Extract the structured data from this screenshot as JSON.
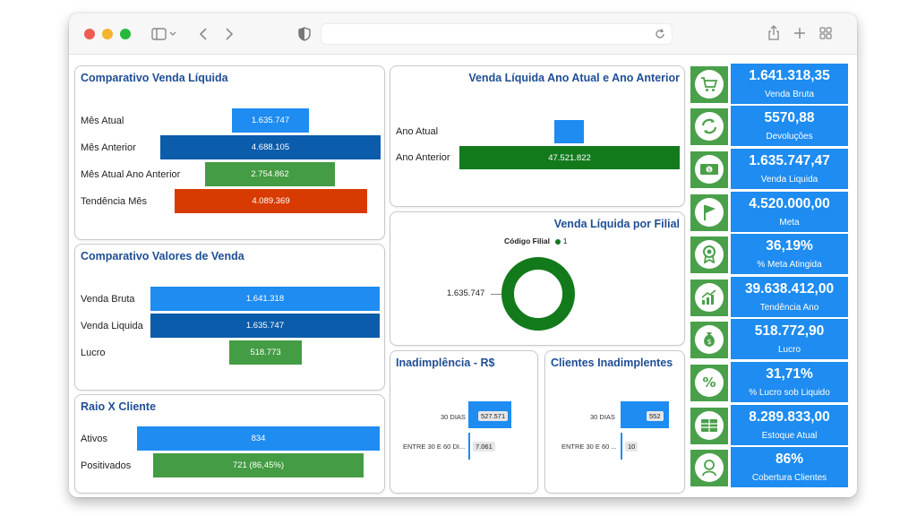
{
  "colors": {
    "primary_blue": "#1e8cf0",
    "dark_blue": "#0b5cab",
    "green_bar": "#449c44",
    "dark_green": "#137a1c",
    "orange": "#d83b01",
    "kpi_icon_green": "#4aa04a",
    "title_blue": "#1f4e96"
  },
  "comparativo_venda_liquida": {
    "title": "Comparativo Venda Líquida",
    "rows": [
      {
        "label": "Mês Atual",
        "value": "1.635.747"
      },
      {
        "label": "Mês Anterior",
        "value": "4.688.105"
      },
      {
        "label": "Mês Atual Ano Anterior",
        "value": "2.754.862"
      },
      {
        "label": "Tendência Mês",
        "value": "4.089.369"
      }
    ]
  },
  "comparativo_valores_venda": {
    "title": "Comparativo Valores de Venda",
    "rows": [
      {
        "label": "Venda Bruta",
        "value": "1.641.318"
      },
      {
        "label": "Venda Liquida",
        "value": "1.635.747"
      },
      {
        "label": "Lucro",
        "value": "518.773"
      }
    ]
  },
  "raio_x_cliente": {
    "title": "Raio X Cliente",
    "rows": [
      {
        "label": "Ativos",
        "value": "834"
      },
      {
        "label": "Positivados",
        "value": "721 (86,45%)"
      }
    ]
  },
  "venda_ano": {
    "title": "Venda Líquida Ano Atual e Ano Anterior",
    "rows": [
      {
        "label": "Ano Atual",
        "value": ""
      },
      {
        "label": "Ano Anterior",
        "value": "47.521.822"
      }
    ]
  },
  "venda_filial": {
    "title": "Venda Líquida por Filial",
    "legend_title": "Código Filial",
    "legend_item": "1",
    "slice_label": "1.635.747"
  },
  "inadimplencia": {
    "title": "Inadimplência - R$",
    "rows": [
      {
        "label": "30 DIAS",
        "value": "527.571",
        "ratio": 1.0
      },
      {
        "label": "ENTRE 30 E 60 DI...",
        "value": "7.061",
        "ratio": 0.013
      }
    ]
  },
  "clientes_inadimplentes": {
    "title": "Clientes Inadimplentes",
    "rows": [
      {
        "label": "30 DIAS",
        "value": "552",
        "ratio": 1.0
      },
      {
        "label": "ENTRE 30 E 60 ...",
        "value": "10",
        "ratio": 0.018
      }
    ]
  },
  "kpis": [
    {
      "value": "1.641.318,35",
      "label": "Venda Bruta",
      "icon": "shopping-cart-icon"
    },
    {
      "value": "5570,88",
      "label": "Devoluções",
      "icon": "refresh-icon"
    },
    {
      "value": "1.635.747,47",
      "label": "Venda Liquida",
      "icon": "cash-icon"
    },
    {
      "value": "4.520.000,00",
      "label": "Meta",
      "icon": "flag-icon"
    },
    {
      "value": "36,19%",
      "label": "% Meta Atingida",
      "icon": "award-icon"
    },
    {
      "value": "39.638.412,00",
      "label": "Tendência Ano",
      "icon": "trend-chart-icon"
    },
    {
      "value": "518.772,90",
      "label": "Lucro",
      "icon": "money-bag-icon"
    },
    {
      "value": "31,71%",
      "label": "% Lucro sob Liquido",
      "icon": "percent-icon"
    },
    {
      "value": "8.289.833,00",
      "label": "Estoque Atual",
      "icon": "stock-icon"
    },
    {
      "value": "86%",
      "label": "Cobertura Clientes",
      "icon": "customer-icon"
    }
  ]
}
